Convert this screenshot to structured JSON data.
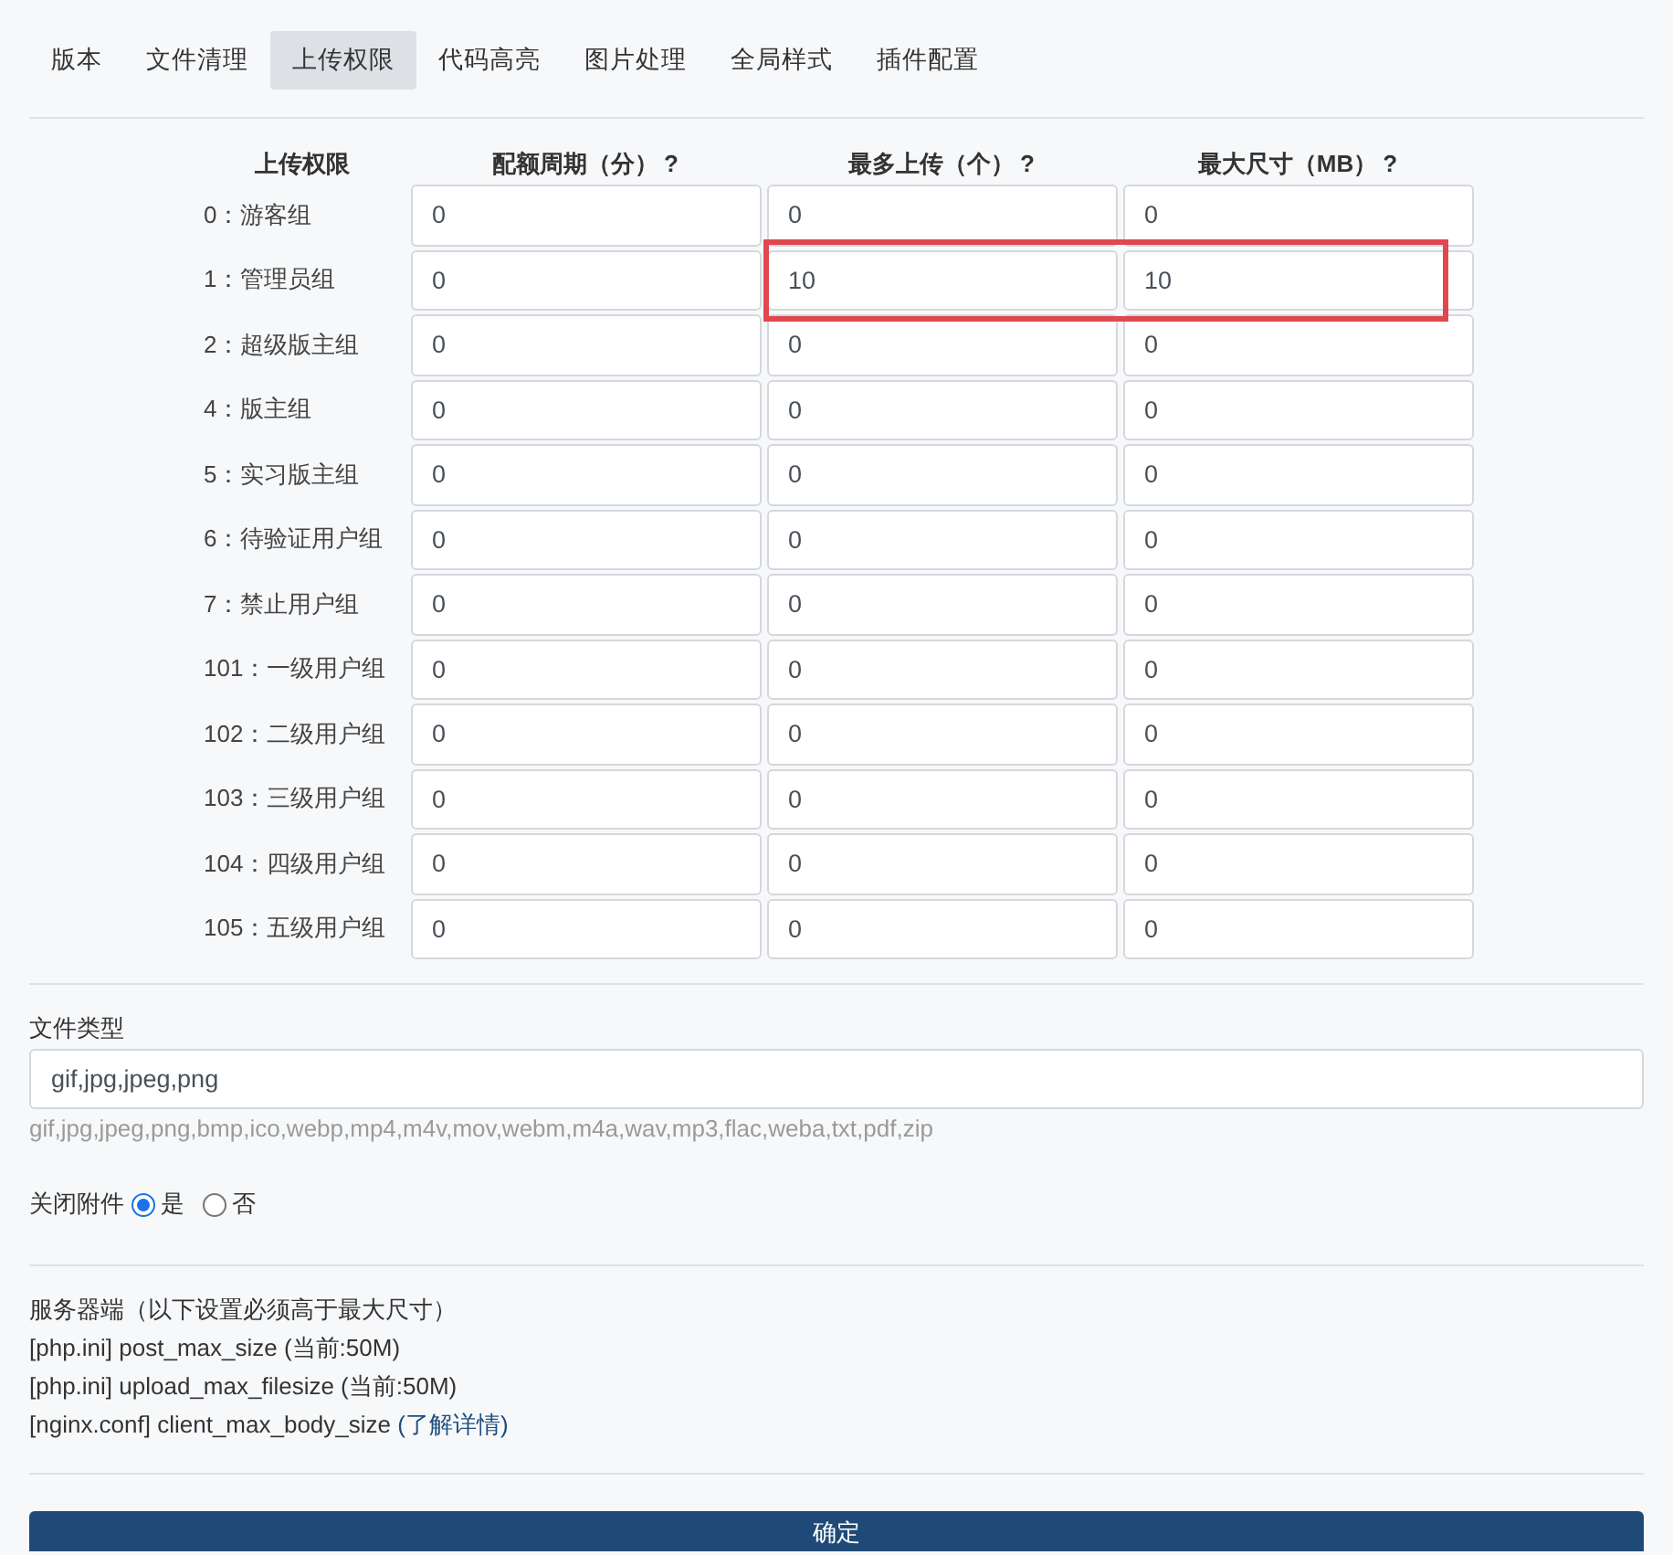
{
  "tabs": [
    {
      "label": "版本",
      "selected": false
    },
    {
      "label": "文件清理",
      "selected": false
    },
    {
      "label": "上传权限",
      "selected": true
    },
    {
      "label": "代码高亮",
      "selected": false
    },
    {
      "label": "图片处理",
      "selected": false
    },
    {
      "label": "全局样式",
      "selected": false
    },
    {
      "label": "插件配置",
      "selected": false
    }
  ],
  "table": {
    "columns": [
      {
        "label": "上传权限"
      },
      {
        "label": "配额周期（分）",
        "help": "?"
      },
      {
        "label": "最多上传（个）",
        "help": "?"
      },
      {
        "label": "最大尺寸（MB）",
        "help": "?"
      }
    ],
    "rows": [
      {
        "label": "0：游客组",
        "cells": [
          {
            "value": "0",
            "highlighted": false
          },
          {
            "value": "0",
            "highlighted": false
          },
          {
            "value": "0",
            "highlighted": false
          }
        ]
      },
      {
        "label": "1：管理员组",
        "cells": [
          {
            "value": "0",
            "highlighted": false
          },
          {
            "value": "10",
            "highlighted": true
          },
          {
            "value": "10",
            "highlighted": true
          }
        ]
      },
      {
        "label": "2：超级版主组",
        "cells": [
          {
            "value": "0",
            "highlighted": false
          },
          {
            "value": "0",
            "highlighted": false
          },
          {
            "value": "0",
            "highlighted": false
          }
        ]
      },
      {
        "label": "4：版主组",
        "cells": [
          {
            "value": "0",
            "highlighted": false
          },
          {
            "value": "0",
            "highlighted": false
          },
          {
            "value": "0",
            "highlighted": false
          }
        ]
      },
      {
        "label": "5：实习版主组",
        "cells": [
          {
            "value": "0",
            "highlighted": false
          },
          {
            "value": "0",
            "highlighted": false
          },
          {
            "value": "0",
            "highlighted": false
          }
        ]
      },
      {
        "label": "6：待验证用户组",
        "cells": [
          {
            "value": "0",
            "highlighted": false
          },
          {
            "value": "0",
            "highlighted": false
          },
          {
            "value": "0",
            "highlighted": false
          }
        ]
      },
      {
        "label": "7：禁止用户组",
        "cells": [
          {
            "value": "0",
            "highlighted": false
          },
          {
            "value": "0",
            "highlighted": false
          },
          {
            "value": "0",
            "highlighted": false
          }
        ]
      },
      {
        "label": "101：一级用户组",
        "cells": [
          {
            "value": "0",
            "highlighted": false
          },
          {
            "value": "0",
            "highlighted": false
          },
          {
            "value": "0",
            "highlighted": false
          }
        ]
      },
      {
        "label": "102：二级用户组",
        "cells": [
          {
            "value": "0",
            "highlighted": false
          },
          {
            "value": "0",
            "highlighted": false
          },
          {
            "value": "0",
            "highlighted": false
          }
        ]
      },
      {
        "label": "103：三级用户组",
        "cells": [
          {
            "value": "0",
            "highlighted": false
          },
          {
            "value": "0",
            "highlighted": false
          },
          {
            "value": "0",
            "highlighted": false
          }
        ]
      },
      {
        "label": "104：四级用户组",
        "cells": [
          {
            "value": "0",
            "highlighted": false
          },
          {
            "value": "0",
            "highlighted": false
          },
          {
            "value": "0",
            "highlighted": false
          }
        ]
      },
      {
        "label": "105：五级用户组",
        "cells": [
          {
            "value": "0",
            "highlighted": false
          },
          {
            "value": "0",
            "highlighted": false
          },
          {
            "value": "0",
            "highlighted": false
          }
        ]
      }
    ]
  },
  "file_types": {
    "label": "文件类型",
    "value": "gif,jpg,jpeg,png",
    "hint": "gif,jpg,jpeg,png,bmp,ico,webp,mp4,m4v,mov,webm,m4a,wav,mp3,flac,weba,txt,pdf,zip"
  },
  "close_attachments": {
    "label": "关闭附件",
    "options": [
      {
        "label": "是",
        "selected": true
      },
      {
        "label": "否",
        "selected": false
      }
    ]
  },
  "server": {
    "title": "服务器端（以下设置必须高于最大尺寸）",
    "lines": [
      {
        "text": "[php.ini] post_max_size (当前:50M)"
      },
      {
        "text": "[php.ini] upload_max_filesize (当前:50M)"
      },
      {
        "text": "[nginx.conf] client_max_body_size ",
        "link": "(了解详情)"
      }
    ]
  },
  "submit": "确定"
}
